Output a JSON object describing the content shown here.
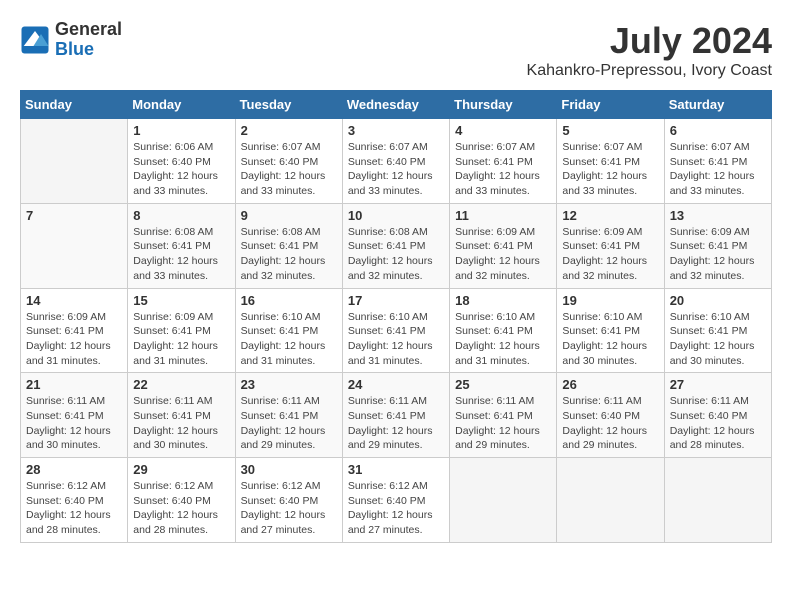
{
  "header": {
    "logo_general": "General",
    "logo_blue": "Blue",
    "month_title": "July 2024",
    "location": "Kahankro-Prepressou, Ivory Coast"
  },
  "weekdays": [
    "Sunday",
    "Monday",
    "Tuesday",
    "Wednesday",
    "Thursday",
    "Friday",
    "Saturday"
  ],
  "weeks": [
    [
      {
        "day": "",
        "info": ""
      },
      {
        "day": "1",
        "info": "Sunrise: 6:06 AM\nSunset: 6:40 PM\nDaylight: 12 hours\nand 33 minutes."
      },
      {
        "day": "2",
        "info": "Sunrise: 6:07 AM\nSunset: 6:40 PM\nDaylight: 12 hours\nand 33 minutes."
      },
      {
        "day": "3",
        "info": "Sunrise: 6:07 AM\nSunset: 6:40 PM\nDaylight: 12 hours\nand 33 minutes."
      },
      {
        "day": "4",
        "info": "Sunrise: 6:07 AM\nSunset: 6:41 PM\nDaylight: 12 hours\nand 33 minutes."
      },
      {
        "day": "5",
        "info": "Sunrise: 6:07 AM\nSunset: 6:41 PM\nDaylight: 12 hours\nand 33 minutes."
      },
      {
        "day": "6",
        "info": "Sunrise: 6:07 AM\nSunset: 6:41 PM\nDaylight: 12 hours\nand 33 minutes."
      }
    ],
    [
      {
        "day": "7",
        "info": ""
      },
      {
        "day": "8",
        "info": "Sunrise: 6:08 AM\nSunset: 6:41 PM\nDaylight: 12 hours\nand 33 minutes."
      },
      {
        "day": "9",
        "info": "Sunrise: 6:08 AM\nSunset: 6:41 PM\nDaylight: 12 hours\nand 32 minutes."
      },
      {
        "day": "10",
        "info": "Sunrise: 6:08 AM\nSunset: 6:41 PM\nDaylight: 12 hours\nand 32 minutes."
      },
      {
        "day": "11",
        "info": "Sunrise: 6:09 AM\nSunset: 6:41 PM\nDaylight: 12 hours\nand 32 minutes."
      },
      {
        "day": "12",
        "info": "Sunrise: 6:09 AM\nSunset: 6:41 PM\nDaylight: 12 hours\nand 32 minutes."
      },
      {
        "day": "13",
        "info": "Sunrise: 6:09 AM\nSunset: 6:41 PM\nDaylight: 12 hours\nand 32 minutes."
      }
    ],
    [
      {
        "day": "14",
        "info": "Sunrise: 6:09 AM\nSunset: 6:41 PM\nDaylight: 12 hours\nand 31 minutes."
      },
      {
        "day": "15",
        "info": "Sunrise: 6:09 AM\nSunset: 6:41 PM\nDaylight: 12 hours\nand 31 minutes."
      },
      {
        "day": "16",
        "info": "Sunrise: 6:10 AM\nSunset: 6:41 PM\nDaylight: 12 hours\nand 31 minutes."
      },
      {
        "day": "17",
        "info": "Sunrise: 6:10 AM\nSunset: 6:41 PM\nDaylight: 12 hours\nand 31 minutes."
      },
      {
        "day": "18",
        "info": "Sunrise: 6:10 AM\nSunset: 6:41 PM\nDaylight: 12 hours\nand 31 minutes."
      },
      {
        "day": "19",
        "info": "Sunrise: 6:10 AM\nSunset: 6:41 PM\nDaylight: 12 hours\nand 30 minutes."
      },
      {
        "day": "20",
        "info": "Sunrise: 6:10 AM\nSunset: 6:41 PM\nDaylight: 12 hours\nand 30 minutes."
      }
    ],
    [
      {
        "day": "21",
        "info": "Sunrise: 6:11 AM\nSunset: 6:41 PM\nDaylight: 12 hours\nand 30 minutes."
      },
      {
        "day": "22",
        "info": "Sunrise: 6:11 AM\nSunset: 6:41 PM\nDaylight: 12 hours\nand 30 minutes."
      },
      {
        "day": "23",
        "info": "Sunrise: 6:11 AM\nSunset: 6:41 PM\nDaylight: 12 hours\nand 29 minutes."
      },
      {
        "day": "24",
        "info": "Sunrise: 6:11 AM\nSunset: 6:41 PM\nDaylight: 12 hours\nand 29 minutes."
      },
      {
        "day": "25",
        "info": "Sunrise: 6:11 AM\nSunset: 6:41 PM\nDaylight: 12 hours\nand 29 minutes."
      },
      {
        "day": "26",
        "info": "Sunrise: 6:11 AM\nSunset: 6:40 PM\nDaylight: 12 hours\nand 29 minutes."
      },
      {
        "day": "27",
        "info": "Sunrise: 6:11 AM\nSunset: 6:40 PM\nDaylight: 12 hours\nand 28 minutes."
      }
    ],
    [
      {
        "day": "28",
        "info": "Sunrise: 6:12 AM\nSunset: 6:40 PM\nDaylight: 12 hours\nand 28 minutes."
      },
      {
        "day": "29",
        "info": "Sunrise: 6:12 AM\nSunset: 6:40 PM\nDaylight: 12 hours\nand 28 minutes."
      },
      {
        "day": "30",
        "info": "Sunrise: 6:12 AM\nSunset: 6:40 PM\nDaylight: 12 hours\nand 27 minutes."
      },
      {
        "day": "31",
        "info": "Sunrise: 6:12 AM\nSunset: 6:40 PM\nDaylight: 12 hours\nand 27 minutes."
      },
      {
        "day": "",
        "info": ""
      },
      {
        "day": "",
        "info": ""
      },
      {
        "day": "",
        "info": ""
      }
    ]
  ]
}
